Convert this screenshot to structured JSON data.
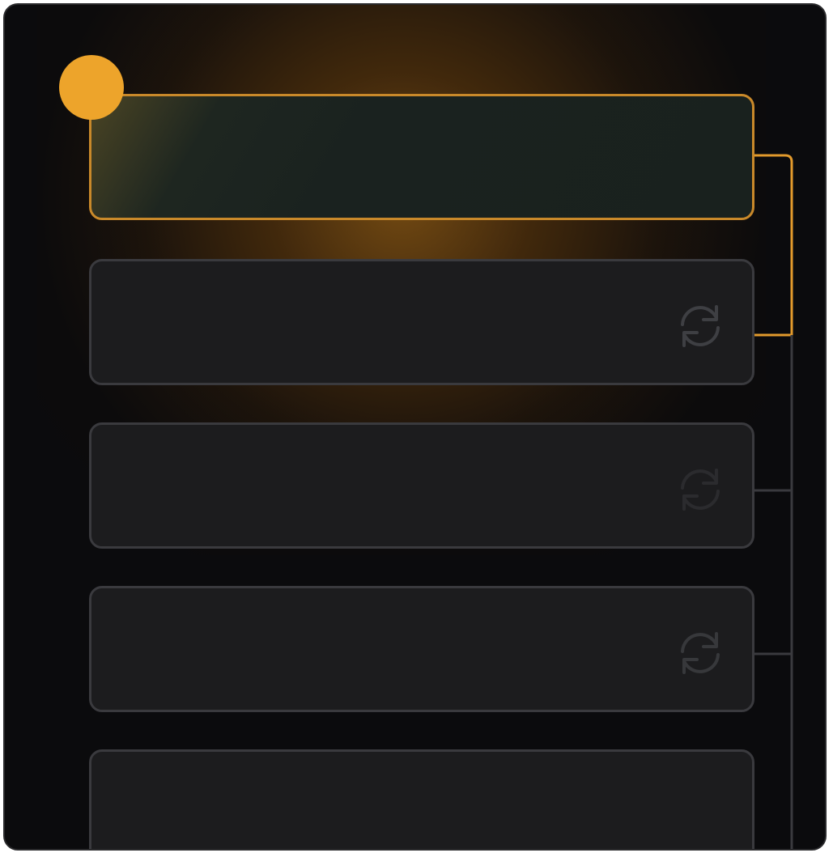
{
  "steps": [
    {
      "state": "active",
      "icon": "none"
    },
    {
      "state": "inactive",
      "icon": "refresh-icon"
    },
    {
      "state": "inactive",
      "icon": "refresh-icon"
    },
    {
      "state": "inactive",
      "icon": "refresh-icon"
    },
    {
      "state": "inactive",
      "icon": "none"
    }
  ],
  "colors": {
    "accent": "#eda42b",
    "active_border": "#c9892a",
    "inactive_border": "#3a3a3e",
    "card_bg": "#1c1c1e",
    "background": "#0b0b0d"
  }
}
